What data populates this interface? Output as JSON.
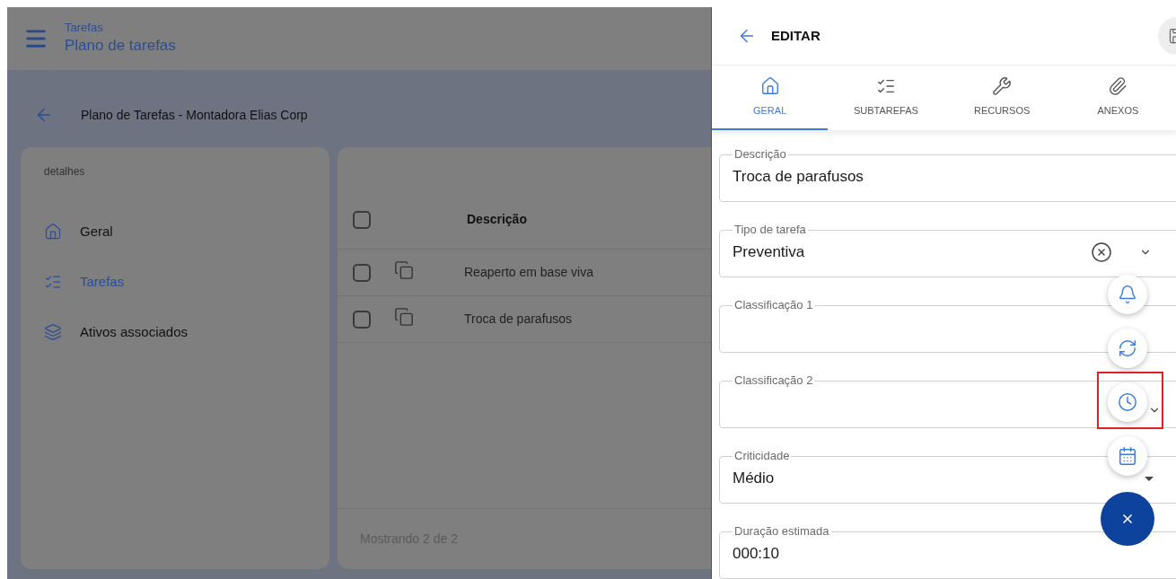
{
  "app_bar": {
    "section": "Tarefas",
    "title": "Plano de tarefas"
  },
  "page": {
    "title": "Plano de Tarefas - Montadora Elias Corp"
  },
  "sidebar": {
    "heading": "detalhes",
    "items": [
      {
        "label": "Geral",
        "kind": "home",
        "selected": false
      },
      {
        "label": "Tarefas",
        "kind": "checklist",
        "selected": true
      },
      {
        "label": "Ativos associados",
        "kind": "layers",
        "selected": false
      }
    ]
  },
  "table": {
    "header": {
      "label": "Descrição",
      "checked": false
    },
    "rows": [
      {
        "description": "Reaperto em base viva",
        "checked": false
      },
      {
        "description": "Troca de parafusos",
        "checked": false
      }
    ],
    "footer": "Mostrando 2 de 2"
  },
  "drawer": {
    "title": "EDITAR",
    "tabs": [
      {
        "label": "GERAL",
        "kind": "home",
        "selected": true
      },
      {
        "label": "SUBTAREFAS",
        "kind": "checklist",
        "selected": false
      },
      {
        "label": "RECURSOS",
        "kind": "wrench",
        "selected": false
      },
      {
        "label": "ANEXOS",
        "kind": "clip",
        "selected": false
      }
    ],
    "fields": [
      {
        "label": "Descrição",
        "value": "Troca de parafusos",
        "kind": "text"
      },
      {
        "label": "Tipo de tarefa",
        "value": "Preventiva",
        "kind": "clearable"
      },
      {
        "label": "Classificação 1",
        "kind": "text"
      },
      {
        "label": "Classificação 2",
        "kind": "select"
      },
      {
        "label": "Criticidade",
        "value": "Médio",
        "kind": "dropdown"
      },
      {
        "label": "Duração estimada",
        "value": "000:10",
        "kind": "text"
      }
    ]
  },
  "fab_actions": [
    {
      "kind": "bell",
      "highlighted": false
    },
    {
      "kind": "refresh",
      "highlighted": false
    },
    {
      "kind": "clock",
      "highlighted": true
    },
    {
      "kind": "calendar",
      "highlighted": false
    }
  ]
}
